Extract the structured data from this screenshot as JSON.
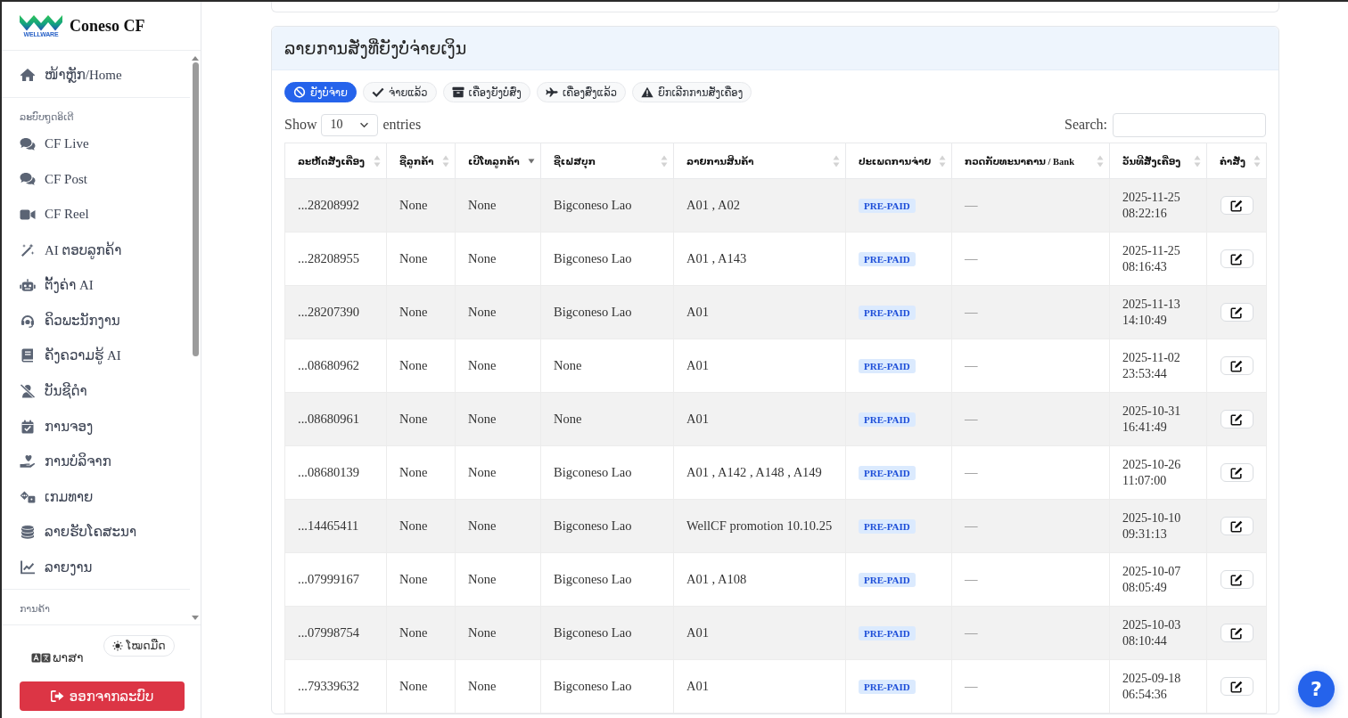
{
  "sidebar": {
    "brand": {
      "name": "Coneso CF",
      "logo_caption": "WELLWARE"
    },
    "home": {
      "label": "ໜ້າຫຼັກ/Home",
      "selected": false
    },
    "sections": [
      {
        "title": "ລະບົບຖູດອິເຕີ",
        "items": [
          {
            "label": "CF Live",
            "selected": false
          },
          {
            "label": "CF Post",
            "selected": false
          },
          {
            "label": "CF Reel",
            "selected": false
          },
          {
            "label": "AI ຕອບລູກຄ້າ",
            "selected": false
          },
          {
            "label": "ຕັ້ງຄ່າ AI",
            "selected": false
          },
          {
            "label": "ຄິວພະນັກງານ",
            "selected": false
          },
          {
            "label": "ຄັງຄວາມຮູ້ AI",
            "selected": false
          },
          {
            "label": "ບັນຊີດຳ",
            "selected": false
          },
          {
            "label": "ການຈອງ",
            "selected": false
          },
          {
            "label": "ການບໍລິຈາກ",
            "selected": false
          },
          {
            "label": "ເກມທາຍ",
            "selected": false
          },
          {
            "label": "ລາຍຮັບໂຄສະນາ",
            "selected": false
          },
          {
            "label": "ລາຍງານ",
            "selected": false
          }
        ]
      },
      {
        "title": "ການຄ້າ"
      }
    ],
    "language": {
      "label": "ພາສາ"
    },
    "theme_toggle": {
      "label": "ໂໝດມືດ"
    },
    "logout": {
      "label": "ອອກຈາກລະບົບ"
    }
  },
  "orders_card": {
    "title": "ລາຍການສັ່ງທີ່ຍັງບໍ່ຈ່າຍເງິນ",
    "filters": [
      {
        "label": "ຍັງບໍ່ຈ່າຍ",
        "selected": true
      },
      {
        "label": "ຈ່າຍແລ້ວ",
        "selected": false
      },
      {
        "label": "ເຄື່ອງຍັງບໍ່ສົ່ງ",
        "selected": false
      },
      {
        "label": "ເຄື່ອງສົ່ງແລ້ວ",
        "selected": false
      },
      {
        "label": "ຍົກເລີກການສັ່ງເຄື່ອງ",
        "selected": false
      }
    ],
    "length_menu": {
      "prefix": "Show",
      "value": "10",
      "suffix": "entries"
    },
    "search": {
      "label": "Search:"
    },
    "table": {
      "columns": [
        {
          "label": "ລະຫັດສັ່ງເຄື່ອງ",
          "sorted": false
        },
        {
          "label": "ຊື່ລູກຄ້າ",
          "sorted": false
        },
        {
          "label": "ເບີໂທລູກຄ້າ",
          "sorted": true
        },
        {
          "label": "ຊື່ເຟສບຸກ",
          "sorted": false
        },
        {
          "label": "ລາຍການສິນຄ້າ",
          "sorted": false
        },
        {
          "label": "ປະເພດການຈ່າຍ",
          "sorted": false
        },
        {
          "label": "ກວດກັບທະນາຄານ / Bank",
          "sorted": false
        },
        {
          "label": "ວັນທີສັ່ງເຄື່ອງ",
          "sorted": false
        },
        {
          "label": "ຄຳສັ່ງ",
          "sorted": false
        }
      ],
      "rows": [
        {
          "order_id": "...28208992",
          "customer_name": "None",
          "phone": "None",
          "facebook_name": "Bigconeso Lao",
          "items": "A01 , A02",
          "payment_type": "PRE-PAID",
          "bank_check": "—",
          "order_date": "2025-11-25 08:22:16"
        },
        {
          "order_id": "...28208955",
          "customer_name": "None",
          "phone": "None",
          "facebook_name": "Bigconeso Lao",
          "items": "A01 , A143",
          "payment_type": "PRE-PAID",
          "bank_check": "—",
          "order_date": "2025-11-25 08:16:43"
        },
        {
          "order_id": "...28207390",
          "customer_name": "None",
          "phone": "None",
          "facebook_name": "Bigconeso Lao",
          "items": "A01",
          "payment_type": "PRE-PAID",
          "bank_check": "—",
          "order_date": "2025-11-13 14:10:49"
        },
        {
          "order_id": "...08680962",
          "customer_name": "None",
          "phone": "None",
          "facebook_name": "None",
          "items": "A01",
          "payment_type": "PRE-PAID",
          "bank_check": "—",
          "order_date": "2025-11-02 23:53:44"
        },
        {
          "order_id": "...08680961",
          "customer_name": "None",
          "phone": "None",
          "facebook_name": "None",
          "items": "A01",
          "payment_type": "PRE-PAID",
          "bank_check": "—",
          "order_date": "2025-10-31 16:41:49"
        },
        {
          "order_id": "...08680139",
          "customer_name": "None",
          "phone": "None",
          "facebook_name": "Bigconeso Lao",
          "items": "A01 , A142 , A148 , A149",
          "payment_type": "PRE-PAID",
          "bank_check": "—",
          "order_date": "2025-10-26 11:07:00"
        },
        {
          "order_id": "...14465411",
          "customer_name": "None",
          "phone": "None",
          "facebook_name": "Bigconeso Lao",
          "items": "WellCF promotion 10.10.25",
          "payment_type": "PRE-PAID",
          "bank_check": "—",
          "order_date": "2025-10-10 09:31:13"
        },
        {
          "order_id": "...07999167",
          "customer_name": "None",
          "phone": "None",
          "facebook_name": "Bigconeso Lao",
          "items": "A01 , A108",
          "payment_type": "PRE-PAID",
          "bank_check": "—",
          "order_date": "2025-10-07 08:05:49"
        },
        {
          "order_id": "...07998754",
          "customer_name": "None",
          "phone": "None",
          "facebook_name": "Bigconeso Lao",
          "items": "A01",
          "payment_type": "PRE-PAID",
          "bank_check": "—",
          "order_date": "2025-10-03 08:10:44"
        },
        {
          "order_id": "...79339632",
          "customer_name": "None",
          "phone": "None",
          "facebook_name": "Bigconeso Lao",
          "items": "A01",
          "payment_type": "PRE-PAID",
          "bank_check": "—",
          "order_date": "2025-09-18 06:54:36"
        }
      ]
    }
  },
  "help_button": {
    "label": "?"
  }
}
